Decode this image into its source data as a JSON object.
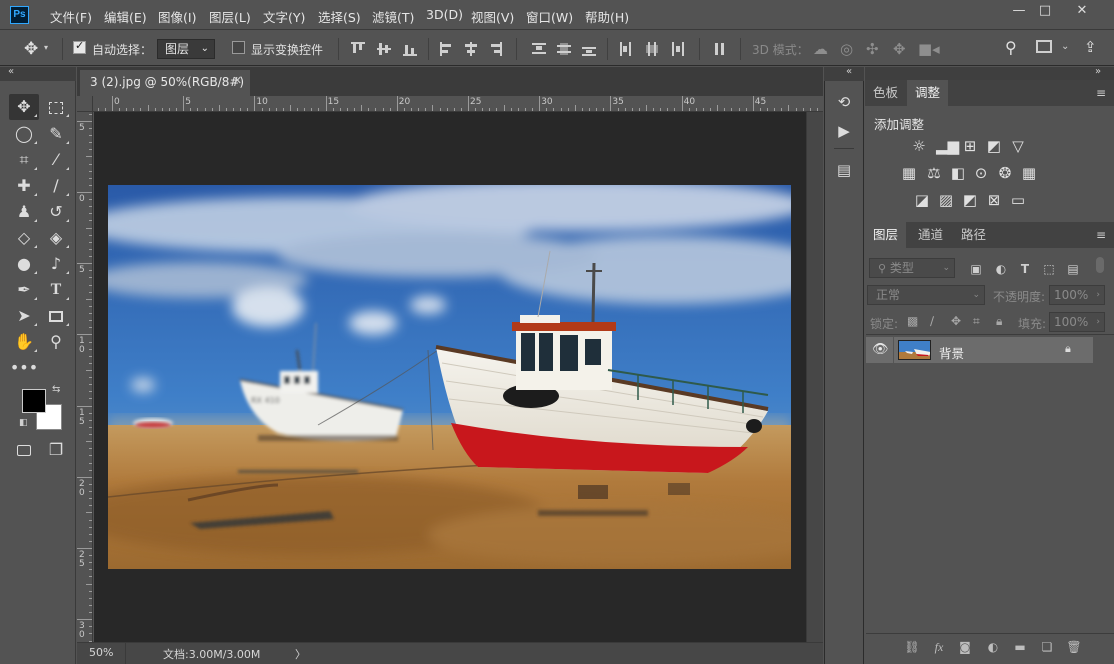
{
  "app": {
    "logo": "Ps"
  },
  "menu": [
    "文件(F)",
    "编辑(E)",
    "图像(I)",
    "图层(L)",
    "文字(Y)",
    "选择(S)",
    "滤镜(T)",
    "3D(D)",
    "视图(V)",
    "窗口(W)",
    "帮助(H)"
  ],
  "window_controls": {
    "minimize": "—",
    "maximize": "□",
    "close": "✕"
  },
  "options_bar": {
    "auto_select_label": "自动选择：",
    "auto_select_checked": true,
    "target_value": "图层",
    "show_transform_label": "显示变换控件",
    "show_transform_checked": false,
    "mode3d_label": "3D 模式："
  },
  "document": {
    "tab_title": "3 (2).jpg @ 50%(RGB/8#)",
    "tab_close": "✕",
    "zoom": "50%",
    "doc_info": "文档:3.00M/3.00M",
    "status_arrow": "〉"
  },
  "ruler": {
    "h_labels": [
      "0",
      "5",
      "10",
      "15",
      "20",
      "25",
      "30",
      "35",
      "40",
      "45"
    ],
    "v_labels": [
      "5",
      "0",
      "5",
      "1\n0",
      "1\n5",
      "2\n0",
      "2\n5",
      "3\n0"
    ]
  },
  "colors": {
    "foreground": "#000000",
    "background": "#ffffff",
    "accent": "#31a8ff"
  },
  "adjustments_panel": {
    "tabs": [
      "色板",
      "调整"
    ],
    "active_tab": "调整",
    "title": "添加调整"
  },
  "layers_panel": {
    "tabs": [
      "图层",
      "通道",
      "路径"
    ],
    "active_tab": "图层",
    "filter_placeholder": "类型",
    "blend_mode": "正常",
    "opacity_label": "不透明度:",
    "opacity_value": "100%",
    "lock_label": "锁定:",
    "fill_label": "填充:",
    "fill_value": "100%",
    "layers": [
      {
        "name": "背景",
        "visible": true,
        "locked": true
      }
    ]
  },
  "dock_icons": [
    "history-icon",
    "actions-play-icon",
    "properties-icon"
  ]
}
